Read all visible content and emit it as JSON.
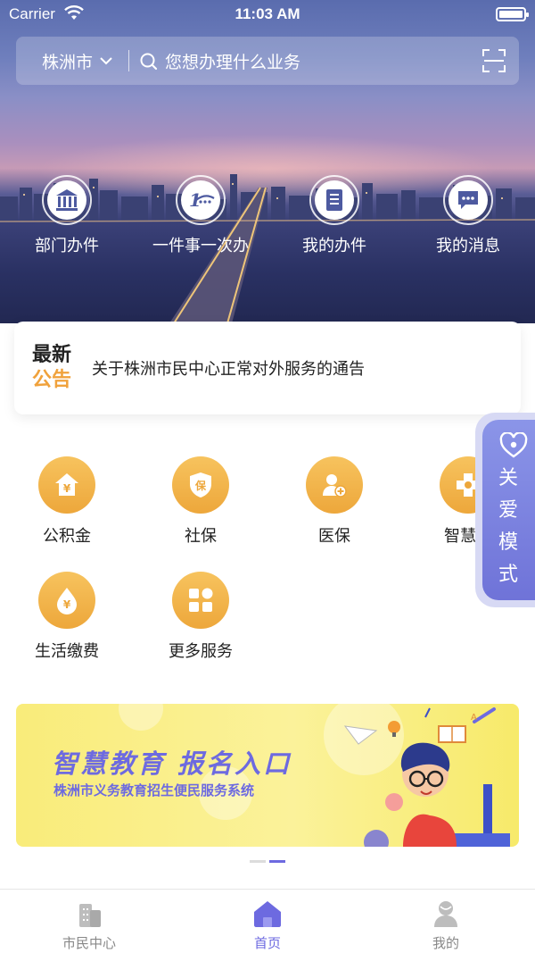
{
  "status_bar": {
    "carrier": "Carrier",
    "time": "11:03 AM"
  },
  "search": {
    "city": "株洲市",
    "placeholder": "您想办理什么业务"
  },
  "shortcuts": [
    {
      "label": "部门办件",
      "icon": "government-building-icon"
    },
    {
      "label": "一件事一次办",
      "icon": "one-thing-icon"
    },
    {
      "label": "我的办件",
      "icon": "document-list-icon"
    },
    {
      "label": "我的消息",
      "icon": "message-icon"
    }
  ],
  "notice": {
    "tag_line1": "最新",
    "tag_line2": "公告",
    "text": "关于株洲市民中心正常对外服务的通告"
  },
  "services": [
    {
      "label": "公积金",
      "icon": "housing-fund-icon"
    },
    {
      "label": "社保",
      "icon": "social-security-icon"
    },
    {
      "label": "医保",
      "icon": "medical-insurance-icon"
    },
    {
      "label": "智慧医",
      "icon": "smart-medical-icon"
    },
    {
      "label": "生活缴费",
      "icon": "utility-payment-icon"
    },
    {
      "label": "更多服务",
      "icon": "more-services-icon"
    }
  ],
  "care_mode": {
    "label": "关爱模式"
  },
  "banner": {
    "title": "智慧教育 报名入口",
    "subtitle": "株洲市义务教育招生便民服务系统"
  },
  "tabbar": [
    {
      "label": "市民中心",
      "active": false
    },
    {
      "label": "首页",
      "active": true
    },
    {
      "label": "我的",
      "active": false
    }
  ],
  "colors": {
    "accent": "#6d6ae0",
    "gold": "#f0a23c",
    "care": "#7c82e0"
  }
}
